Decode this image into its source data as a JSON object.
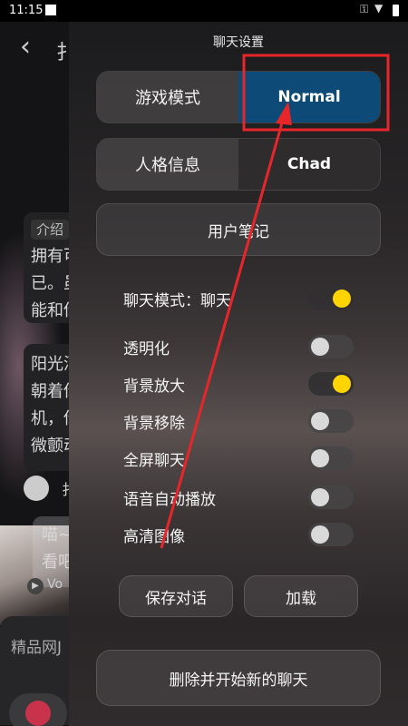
{
  "status_bar": {
    "time": "11:15"
  },
  "background_app": {
    "title_char": "扌",
    "card1": {
      "tag": "介绍",
      "lines": [
        "拥有可",
        "已。虽",
        "能和你"
      ]
    },
    "card2": {
      "lines": [
        "阳光洒",
        "朝着你",
        "机，你",
        "微颤动"
      ]
    },
    "speaker_char": "扌",
    "card3": {
      "lines": [
        "喵~",
        "看吧"
      ]
    },
    "voice_label": "Vo",
    "input_placeholder": "精品网J"
  },
  "settings": {
    "title": "聊天设置",
    "game_mode": {
      "label": "游戏模式",
      "value": "Normal"
    },
    "persona": {
      "label": "人格信息",
      "value": "Chad"
    },
    "user_notes_label": "用户笔记",
    "toggles": [
      {
        "label": "聊天模式：聊天",
        "on": true
      },
      {
        "label": "透明化",
        "on": false
      },
      {
        "label": "背景放大",
        "on": true
      },
      {
        "label": "背景移除",
        "on": false
      },
      {
        "label": "全屏聊天",
        "on": false
      },
      {
        "label": "语音自动播放",
        "on": false
      },
      {
        "label": "高清图像",
        "on": false
      }
    ],
    "save_label": "保存对话",
    "load_label": "加载",
    "new_chat_label": "删除并开始新的聊天"
  },
  "colors": {
    "accent_blue": "#0d4a78",
    "toggle_on": "#ffd400",
    "annotation_red": "#e8262a"
  }
}
